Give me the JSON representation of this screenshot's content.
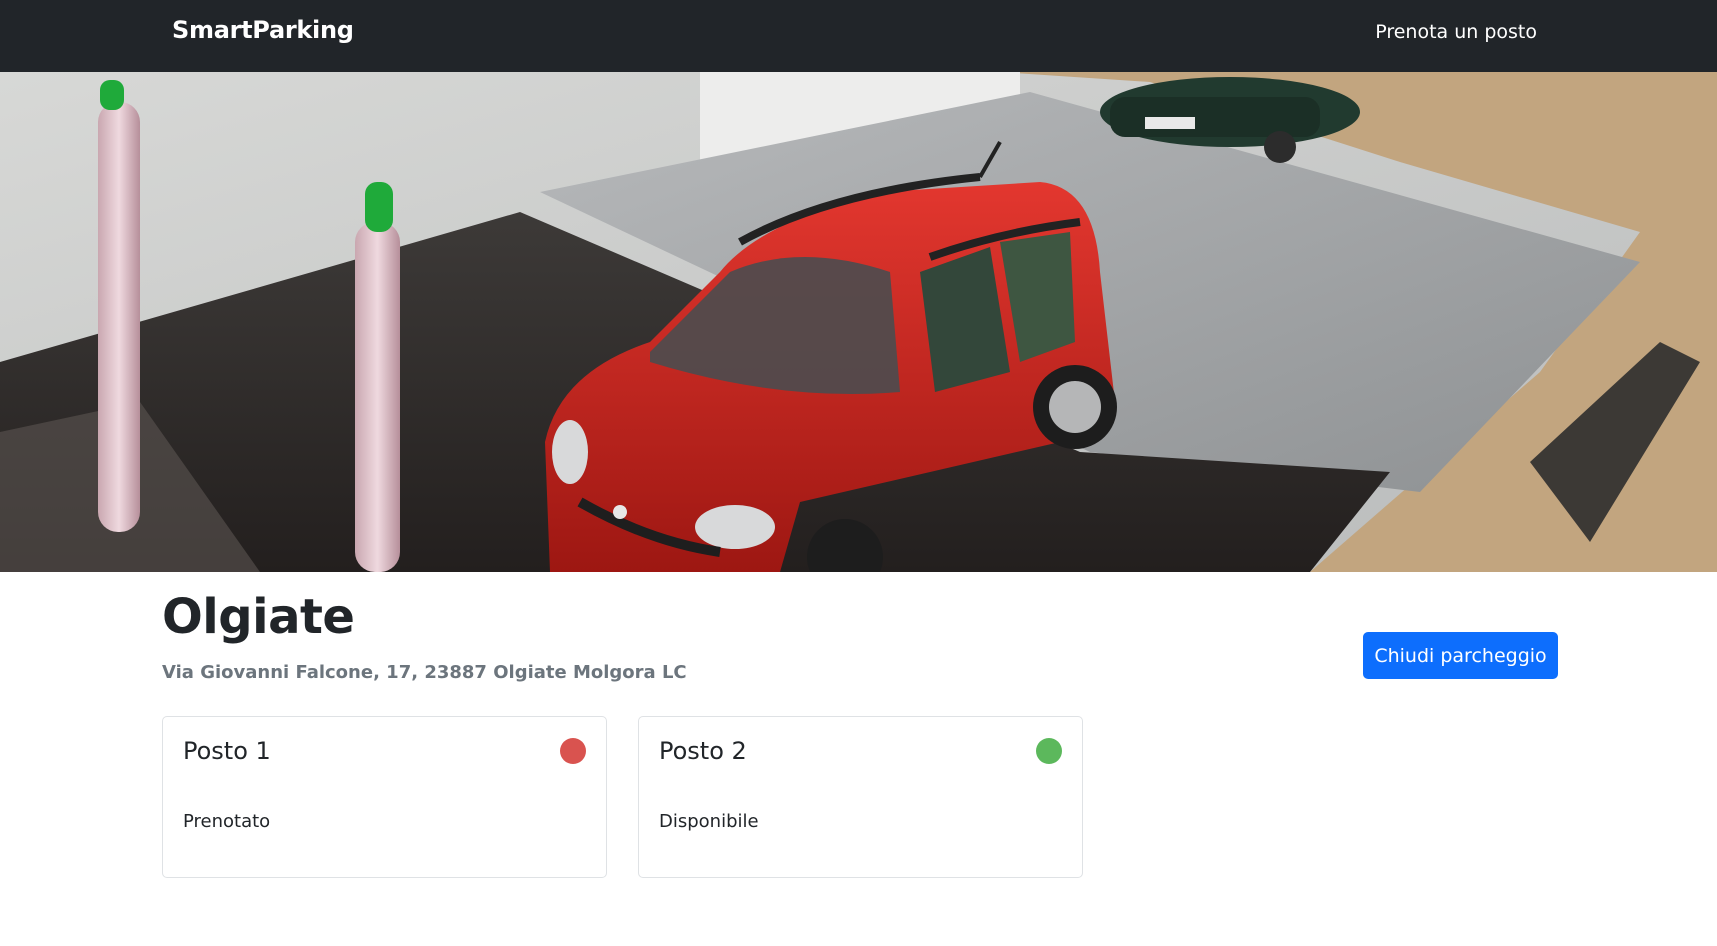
{
  "navbar": {
    "brand": "SmartParking",
    "link": "Prenota un posto"
  },
  "hero": {
    "image": "toy-parking-lot-photo"
  },
  "parking": {
    "name": "Olgiate",
    "address": "Via Giovanni Falcone, 17, 23887 Olgiate Molgora LC",
    "close_button": "Chiudi parcheggio"
  },
  "spots": [
    {
      "title": "Posto 1",
      "status": "Prenotato",
      "status_color": "#d9534f"
    },
    {
      "title": "Posto 2",
      "status": "Disponibile",
      "status_color": "#5cb85c"
    }
  ],
  "colors": {
    "navbar_bg": "#212529",
    "primary": "#0d6efd",
    "muted": "#6c757d"
  }
}
